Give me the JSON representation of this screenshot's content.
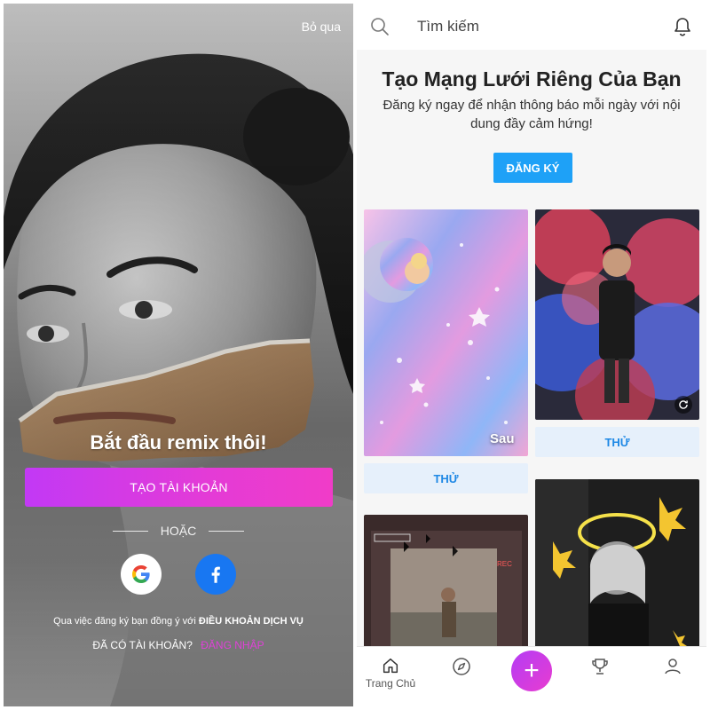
{
  "left_screen": {
    "skip_label": "Bỏ qua",
    "headline": "Bắt đầu remix thôi!",
    "create_account_label": "TẠO TÀI KHOẢN",
    "or_label": "HOẶC",
    "social": [
      "google-icon",
      "facebook-icon"
    ],
    "terms_prefix": "Qua việc đăng ký bạn đồng ý với",
    "terms_link": "ĐIỀU KHOẢN DỊCH VỤ",
    "have_account_label": "ĐÃ CÓ TÀI KHOẢN?",
    "login_label": "ĐĂNG NHẬP",
    "colors": {
      "button_gradient_start": "#c239f5",
      "button_gradient_end": "#f03cc8",
      "login_link": "#e040d8",
      "facebook": "#1877f2"
    }
  },
  "right_screen": {
    "search_placeholder": "Tìm kiếm",
    "promo_title": "Tạo Mạng Lưới Riêng Của Bạn",
    "promo_subtitle": "Đăng ký ngay để nhận thông báo mỗi ngày với nội dung đầy cảm hứng!",
    "signup_label": "ĐĂNG KÝ",
    "cards": [
      {
        "label": "Sau",
        "try_label": "THỬ"
      },
      {
        "label": "",
        "try_label": "THỬ"
      }
    ],
    "bottom_nav": {
      "home_label": "Trang Chủ",
      "items": [
        "home-icon",
        "compass-icon",
        "plus-icon",
        "trophy-icon",
        "profile-icon"
      ]
    },
    "colors": {
      "accent_blue": "#1ea1f7",
      "try_text": "#1e88e5",
      "try_bg": "#e6f0fb"
    }
  }
}
